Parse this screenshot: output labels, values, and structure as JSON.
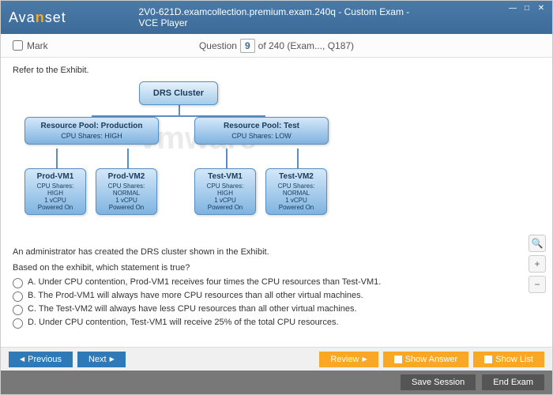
{
  "window": {
    "logo_pre": "Ava",
    "logo_accent": "n",
    "logo_post": "set",
    "title": "2V0-621D.examcollection.premium.exam.240q - Custom Exam - VCE Player",
    "min": "—",
    "max": "□",
    "close": "✕"
  },
  "qbar": {
    "mark": "Mark",
    "question_label": "Question",
    "num": "9",
    "total": "of 240 (Exam..., Q187)"
  },
  "content": {
    "refer": "Refer to the Exhibit.",
    "watermark": "vmware",
    "top_node": "DRS Cluster",
    "pool1_t": "Resource Pool:  Production",
    "pool1_s": "CPU Shares:  HIGH",
    "pool2_t": "Resource Pool:  Test",
    "pool2_s": "CPU Shares: LOW",
    "vm1_t": "Prod-VM1",
    "vm1_a": "CPU Shares:",
    "vm1_b": "HIGH",
    "vm1_c": "1 vCPU",
    "vm1_d": "Powered On",
    "vm2_t": "Prod-VM2",
    "vm2_a": "CPU Shares:",
    "vm2_b": "NORMAL",
    "vm2_c": "1 vCPU",
    "vm2_d": "Powered On",
    "vm3_t": "Test-VM1",
    "vm3_a": "CPU Shares:",
    "vm3_b": "HIGH",
    "vm3_c": "1 vCPU",
    "vm3_d": "Powered On",
    "vm4_t": "Test-VM2",
    "vm4_a": "CPU Shares:",
    "vm4_b": "NORMAL",
    "vm4_c": "1 vCPU",
    "vm4_d": "Powered On",
    "line1": "An administrator has created the DRS cluster shown in the Exhibit.",
    "line2": "Based on the exhibit, which statement is true?",
    "optA": "A.   Under CPU contention, Prod-VM1 receives four times the CPU resources than Test-VM1.",
    "optB": "B.   The Prod-VM1 will always have more CPU resources than all other virtual machines.",
    "optC": "C.   The Test-VM2 will always have less CPU resources than all other virtual machines.",
    "optD": "D.   Under CPU contention, Test-VM1 will receive 25% of the total CPU resources."
  },
  "side": {
    "search": "🔍",
    "plus": "+",
    "minus": "−"
  },
  "footer": {
    "previous": "Previous",
    "next": "Next",
    "review": "Review",
    "show_answer": "Show Answer",
    "show_list": "Show List",
    "save_session": "Save Session",
    "end_exam": "End Exam"
  }
}
